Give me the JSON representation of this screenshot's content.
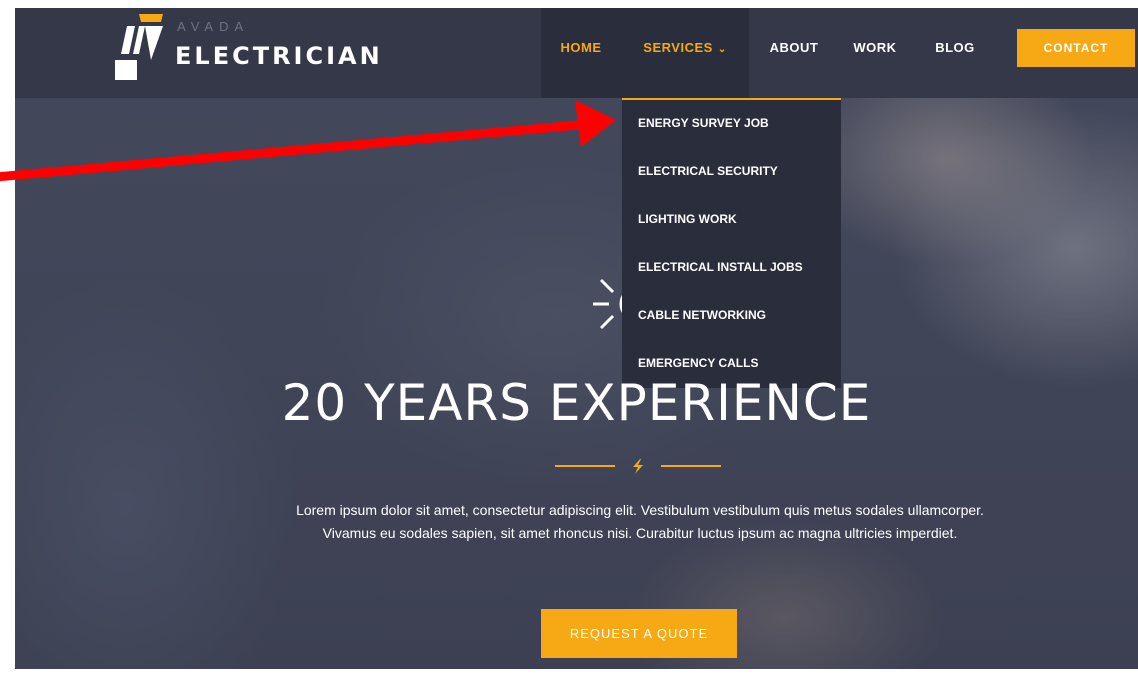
{
  "brand": {
    "small": "AVADA",
    "name": "ELECTRICIAN"
  },
  "nav": {
    "items": [
      {
        "label": "HOME"
      },
      {
        "label": "SERVICES"
      },
      {
        "label": "ABOUT"
      },
      {
        "label": "WORK"
      },
      {
        "label": "BLOG"
      }
    ],
    "services_chevron": "⌄",
    "contact_label": "CONTACT"
  },
  "dropdown": {
    "items": [
      {
        "label": "ENERGY SURVEY JOB"
      },
      {
        "label": "ELECTRICAL SECURITY"
      },
      {
        "label": "LIGHTING WORK"
      },
      {
        "label": "ELECTRICAL INSTALL JOBS"
      },
      {
        "label": "CABLE NETWORKING"
      },
      {
        "label": "EMERGENCY CALLS"
      }
    ]
  },
  "hero": {
    "title": "20 YEARS EXPERIENCE",
    "text": "Lorem ipsum dolor sit amet, consectetur adipiscing elit. Vestibulum vestibulum quis metus sodales ullamcorper. Vivamus eu sodales sapien, sit amet rhoncus nisi. Curabitur luctus ipsum ac magna ultricies imperdiet.",
    "button_label": "REQUEST A QUOTE"
  },
  "icons": {
    "logo": "logo-mark-icon",
    "bulb": "lightbulb-icon",
    "bolt": "lightning-bolt-icon",
    "annotation": "red-arrow-annotation"
  },
  "colors": {
    "accent": "#f7a815",
    "header_bg": "#343848",
    "dropdown_bg": "#2a2d3b",
    "annotation_red": "#ff0000"
  }
}
